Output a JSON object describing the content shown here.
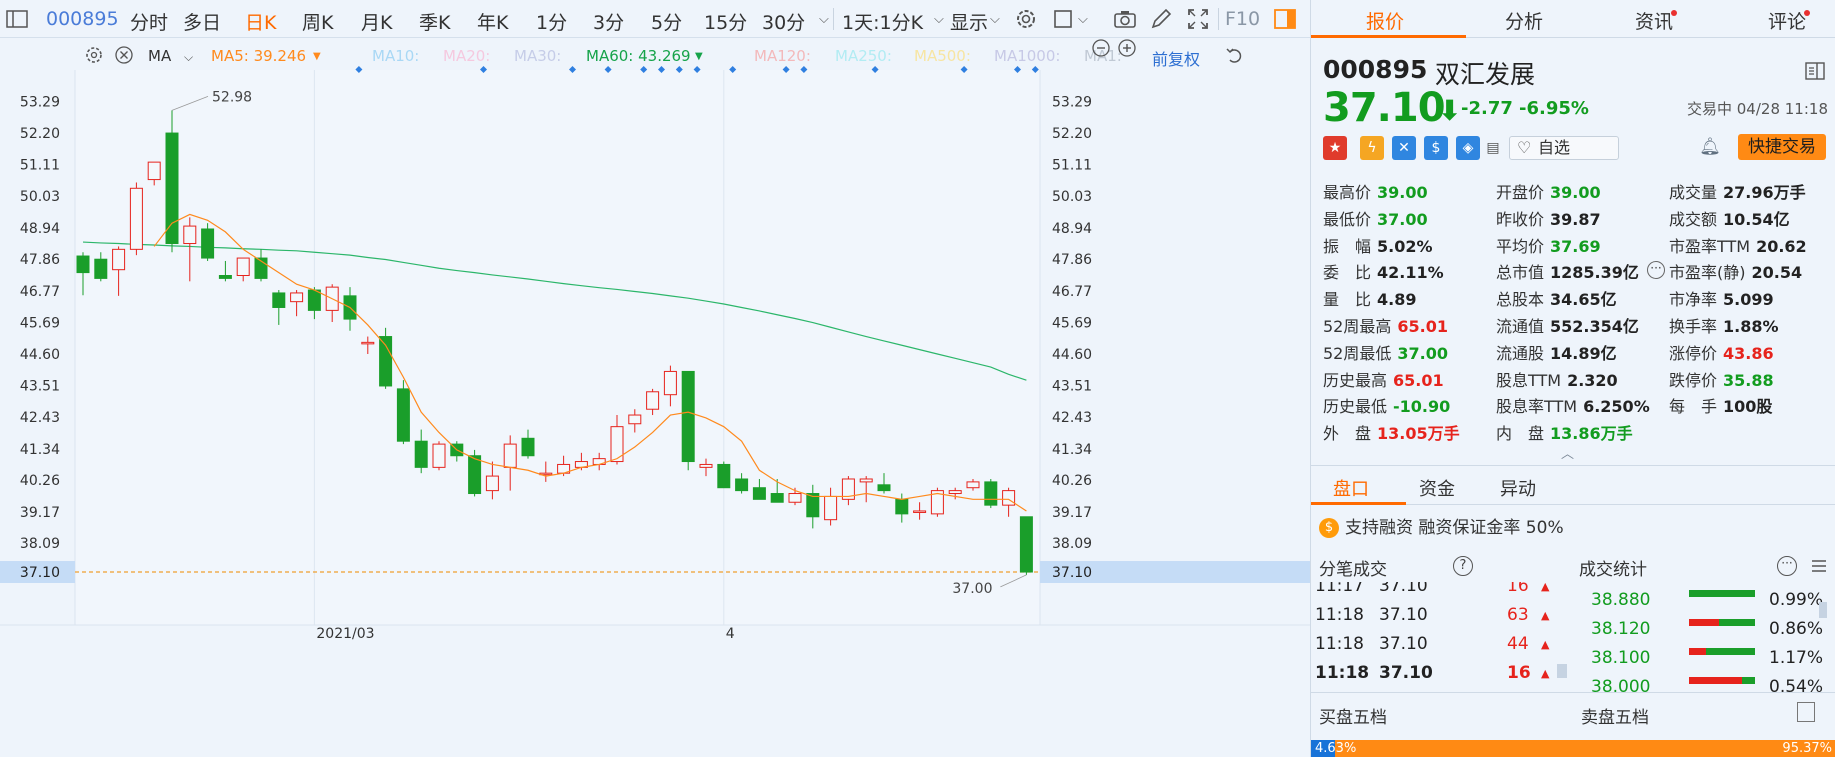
{
  "toolbar": {
    "code": "000895",
    "periods": [
      "分时",
      "多日",
      "日K",
      "周K",
      "月K",
      "季K",
      "年K",
      "1分",
      "3分",
      "5分",
      "15分",
      "30分"
    ],
    "active_period": "日K",
    "cycle_select": "1天:1分K",
    "display_menu": "显示",
    "f10": "F10",
    "icons": [
      "sidebar-toggle-icon",
      "gear-icon",
      "rectangle-icon",
      "camera-icon",
      "pen-icon",
      "fullscreen-icon",
      "layout-icon"
    ]
  },
  "ma_row": {
    "indicator": "MA",
    "ma5": "MA5: 39.246",
    "ma10": "MA10:",
    "ma20": "MA20:",
    "ma30": "MA30:",
    "ma60": "MA60: 43.269",
    "ma120": "MA120:",
    "ma250": "MA250:",
    "ma500": "MA500:",
    "ma1000": "MA1000:",
    "ma1": "MA1:",
    "adjust": "前复权",
    "colors": {
      "ma5": "#ff8a1d",
      "ma60": "#16a34a",
      "faded": "#b8c4d2"
    }
  },
  "chart_data": {
    "type": "candlestick",
    "y_ticks": [
      53.29,
      52.2,
      51.11,
      50.03,
      48.94,
      47.86,
      46.77,
      45.69,
      44.6,
      43.51,
      42.43,
      41.34,
      40.26,
      39.17,
      38.09,
      37.1
    ],
    "ylim": [
      36.55,
      53.75
    ],
    "x_tick_labels": [
      {
        "label": "2021/03",
        "index": 13
      },
      {
        "label": "4",
        "index": 36
      }
    ],
    "max_label": "52.98",
    "min_label": "37.00",
    "last_price_label": "37.10",
    "candles": [
      {
        "o": 47.97,
        "h": 48.1,
        "l": 46.62,
        "c": 47.4
      },
      {
        "o": 47.86,
        "h": 48.1,
        "l": 47.1,
        "c": 47.2
      },
      {
        "o": 47.5,
        "h": 48.3,
        "l": 46.6,
        "c": 48.2
      },
      {
        "o": 48.2,
        "h": 50.5,
        "l": 48.0,
        "c": 50.3
      },
      {
        "o": 50.6,
        "h": 51.1,
        "l": 50.4,
        "c": 51.2
      },
      {
        "o": 52.2,
        "h": 52.98,
        "l": 48.1,
        "c": 48.4
      },
      {
        "o": 48.4,
        "h": 49.3,
        "l": 47.1,
        "c": 49.0
      },
      {
        "o": 48.9,
        "h": 49.1,
        "l": 47.8,
        "c": 47.9
      },
      {
        "o": 47.3,
        "h": 47.8,
        "l": 47.1,
        "c": 47.2
      },
      {
        "o": 47.3,
        "h": 47.9,
        "l": 47.1,
        "c": 47.9
      },
      {
        "o": 47.9,
        "h": 48.2,
        "l": 47.1,
        "c": 47.2
      },
      {
        "o": 46.7,
        "h": 46.8,
        "l": 45.6,
        "c": 46.2
      },
      {
        "o": 46.4,
        "h": 46.8,
        "l": 45.9,
        "c": 46.7
      },
      {
        "o": 46.8,
        "h": 46.9,
        "l": 45.8,
        "c": 46.1
      },
      {
        "o": 46.1,
        "h": 47.0,
        "l": 45.7,
        "c": 46.9
      },
      {
        "o": 46.6,
        "h": 46.9,
        "l": 45.4,
        "c": 45.8
      },
      {
        "o": 45.0,
        "h": 45.2,
        "l": 44.6,
        "c": 45.0
      },
      {
        "o": 45.2,
        "h": 45.5,
        "l": 43.4,
        "c": 43.5
      },
      {
        "o": 43.4,
        "h": 43.7,
        "l": 41.5,
        "c": 41.6
      },
      {
        "o": 41.6,
        "h": 42.0,
        "l": 40.5,
        "c": 40.7
      },
      {
        "o": 40.7,
        "h": 41.6,
        "l": 40.6,
        "c": 41.5
      },
      {
        "o": 41.5,
        "h": 41.6,
        "l": 40.9,
        "c": 41.1
      },
      {
        "o": 41.1,
        "h": 41.3,
        "l": 39.7,
        "c": 39.8
      },
      {
        "o": 39.9,
        "h": 40.9,
        "l": 39.6,
        "c": 40.4
      },
      {
        "o": 40.7,
        "h": 41.8,
        "l": 39.9,
        "c": 41.5
      },
      {
        "o": 41.7,
        "h": 42.0,
        "l": 41.0,
        "c": 41.1
      },
      {
        "o": 40.5,
        "h": 40.9,
        "l": 40.2,
        "c": 40.5
      },
      {
        "o": 40.5,
        "h": 41.1,
        "l": 40.4,
        "c": 40.8
      },
      {
        "o": 40.7,
        "h": 41.2,
        "l": 40.6,
        "c": 40.9
      },
      {
        "o": 40.8,
        "h": 41.2,
        "l": 40.6,
        "c": 41.0
      },
      {
        "o": 40.9,
        "h": 42.5,
        "l": 40.8,
        "c": 42.1
      },
      {
        "o": 42.2,
        "h": 42.7,
        "l": 41.9,
        "c": 42.5
      },
      {
        "o": 42.7,
        "h": 43.4,
        "l": 42.5,
        "c": 43.3
      },
      {
        "o": 43.2,
        "h": 44.2,
        "l": 42.8,
        "c": 44.0
      },
      {
        "o": 44.0,
        "h": 44.0,
        "l": 40.6,
        "c": 40.9
      },
      {
        "o": 40.7,
        "h": 41.0,
        "l": 40.4,
        "c": 40.8
      },
      {
        "o": 40.8,
        "h": 40.9,
        "l": 40.0,
        "c": 40.0
      },
      {
        "o": 40.3,
        "h": 40.5,
        "l": 39.8,
        "c": 39.9
      },
      {
        "o": 40.0,
        "h": 40.3,
        "l": 39.6,
        "c": 39.6
      },
      {
        "o": 39.8,
        "h": 40.3,
        "l": 39.5,
        "c": 39.5
      },
      {
        "o": 39.5,
        "h": 40.0,
        "l": 39.4,
        "c": 39.8
      },
      {
        "o": 39.8,
        "h": 40.1,
        "l": 38.6,
        "c": 39.0
      },
      {
        "o": 38.9,
        "h": 40.0,
        "l": 38.7,
        "c": 39.7
      },
      {
        "o": 39.6,
        "h": 40.4,
        "l": 39.4,
        "c": 40.3
      },
      {
        "o": 40.2,
        "h": 40.4,
        "l": 39.5,
        "c": 40.3
      },
      {
        "o": 40.1,
        "h": 40.5,
        "l": 39.8,
        "c": 39.9
      },
      {
        "o": 39.6,
        "h": 39.8,
        "l": 38.8,
        "c": 39.1
      },
      {
        "o": 39.2,
        "h": 39.5,
        "l": 38.9,
        "c": 39.2
      },
      {
        "o": 39.1,
        "h": 40.0,
        "l": 39.0,
        "c": 39.9
      },
      {
        "o": 39.8,
        "h": 40.0,
        "l": 39.6,
        "c": 39.9
      },
      {
        "o": 40.0,
        "h": 40.3,
        "l": 39.9,
        "c": 40.2
      },
      {
        "o": 40.2,
        "h": 40.3,
        "l": 39.3,
        "c": 39.4
      },
      {
        "o": 39.4,
        "h": 40.0,
        "l": 39.0,
        "c": 39.9
      },
      {
        "o": 39.0,
        "h": 39.0,
        "l": 37.0,
        "c": 37.1
      }
    ],
    "ma5": [
      null,
      null,
      null,
      null,
      48.3,
      49.1,
      49.4,
      49.2,
      48.8,
      48.2,
      47.8,
      47.4,
      47.0,
      46.8,
      46.5,
      46.2,
      45.6,
      44.9,
      43.8,
      42.6,
      41.9,
      41.3,
      41.0,
      40.8,
      40.7,
      40.6,
      40.4,
      40.5,
      40.7,
      40.8,
      41.0,
      41.4,
      41.9,
      42.5,
      42.6,
      42.4,
      42.1,
      41.6,
      40.6,
      40.2,
      39.9,
      39.7,
      39.7,
      39.7,
      39.8,
      39.7,
      39.6,
      39.7,
      39.8,
      39.7,
      39.6,
      39.6,
      39.6,
      39.2
    ],
    "ma60": [
      48.45,
      48.42,
      48.4,
      48.37,
      48.35,
      48.32,
      48.3,
      48.27,
      48.25,
      48.22,
      48.2,
      48.17,
      48.15,
      48.1,
      48.05,
      48.0,
      47.92,
      47.85,
      47.75,
      47.65,
      47.55,
      47.47,
      47.4,
      47.32,
      47.25,
      47.18,
      47.1,
      47.02,
      46.95,
      46.88,
      46.82,
      46.75,
      46.68,
      46.6,
      46.52,
      46.42,
      46.32,
      46.2,
      46.08,
      45.95,
      45.82,
      45.68,
      45.52,
      45.36,
      45.2,
      45.05,
      44.9,
      44.75,
      44.6,
      44.45,
      44.3,
      44.15,
      43.9,
      43.7
    ],
    "event_markers": [
      15,
      22,
      27,
      29,
      31,
      32,
      33,
      34,
      36,
      39,
      40,
      44,
      49,
      52,
      53
    ]
  },
  "quote": {
    "code": "000895",
    "name": "双汇发展",
    "price": "37.10",
    "change": "-2.77",
    "change_pct": "-6.95%",
    "status": "交易中 04/28 11:18",
    "watch_label": "自选",
    "quick_trade_label": "快捷交易",
    "rows": [
      [
        {
          "l": "最高价",
          "v": "39.00",
          "c": "g"
        },
        {
          "l": "开盘价",
          "v": "39.00",
          "c": "g"
        },
        {
          "l": "成交量",
          "v": "27.96万手",
          "c": "k"
        }
      ],
      [
        {
          "l": "最低价",
          "v": "37.00",
          "c": "g"
        },
        {
          "l": "昨收价",
          "v": "39.87",
          "c": "k"
        },
        {
          "l": "成交额",
          "v": "10.54亿",
          "c": "k"
        }
      ],
      [
        {
          "l": "振　幅",
          "v": "5.02%",
          "c": "k"
        },
        {
          "l": "平均价",
          "v": "37.69",
          "c": "g"
        },
        {
          "l": "市盈率TTM",
          "v": "20.62",
          "c": "k"
        }
      ],
      [
        {
          "l": "委　比",
          "v": "42.11%",
          "c": "k"
        },
        {
          "l": "总市值",
          "v": "1285.39亿",
          "c": "k"
        },
        {
          "l": "市盈率(静)",
          "v": "20.54",
          "c": "k"
        }
      ],
      [
        {
          "l": "量　比",
          "v": "4.89",
          "c": "k"
        },
        {
          "l": "总股本",
          "v": "34.65亿",
          "c": "k"
        },
        {
          "l": "市净率",
          "v": "5.099",
          "c": "k"
        }
      ],
      [
        {
          "l": "52周最高",
          "v": "65.01",
          "c": "r"
        },
        {
          "l": "流通值",
          "v": "552.354亿",
          "c": "k"
        },
        {
          "l": "换手率",
          "v": "1.88%",
          "c": "k"
        }
      ],
      [
        {
          "l": "52周最低",
          "v": "37.00",
          "c": "g"
        },
        {
          "l": "流通股",
          "v": "14.89亿",
          "c": "k"
        },
        {
          "l": "涨停价",
          "v": "43.86",
          "c": "r"
        }
      ],
      [
        {
          "l": "历史最高",
          "v": "65.01",
          "c": "r"
        },
        {
          "l": "股息TTM",
          "v": "2.320",
          "c": "k"
        },
        {
          "l": "跌停价",
          "v": "35.88",
          "c": "g"
        }
      ],
      [
        {
          "l": "历史最低",
          "v": "-10.90",
          "c": "g"
        },
        {
          "l": "股息率TTM",
          "v": "6.250%",
          "c": "k"
        },
        {
          "l": "每　手",
          "v": "100股",
          "c": "k"
        }
      ],
      [
        {
          "l": "外　盘",
          "v": "13.05万手",
          "c": "r"
        },
        {
          "l": "内　盘",
          "v": "13.86万手",
          "c": "g"
        }
      ]
    ]
  },
  "right_tabs": [
    "报价",
    "分析",
    "资讯",
    "评论"
  ],
  "sub_tabs": [
    "盘口",
    "资金",
    "异动"
  ],
  "margin_text": "支持融资 融资保证金率 50%",
  "trades": {
    "header": "分笔成交",
    "rows": [
      {
        "t": "11:17",
        "p": "37.10",
        "v": "16"
      },
      {
        "t": "11:18",
        "p": "37.10",
        "v": "63"
      },
      {
        "t": "11:18",
        "p": "37.10",
        "v": "44"
      },
      {
        "t": "11:18",
        "p": "37.10",
        "v": "16"
      }
    ]
  },
  "stats": {
    "header": "成交统计",
    "rows": [
      {
        "p": "38.880",
        "pct": "0.99%",
        "buy": 1.0,
        "sell": 0.0
      },
      {
        "p": "38.120",
        "pct": "0.86%",
        "buy": 0.55,
        "sell": 0.45
      },
      {
        "p": "38.100",
        "pct": "1.17%",
        "buy": 0.75,
        "sell": 0.25
      },
      {
        "p": "38.000",
        "pct": "0.54%",
        "buy": 0.2,
        "sell": 0.8
      }
    ]
  },
  "book": {
    "buy_label": "买盘五档",
    "sell_label": "卖盘五档",
    "buy_ratio": "4.63%",
    "sell_ratio": "95.37%",
    "buy_fraction": 0.0463
  }
}
